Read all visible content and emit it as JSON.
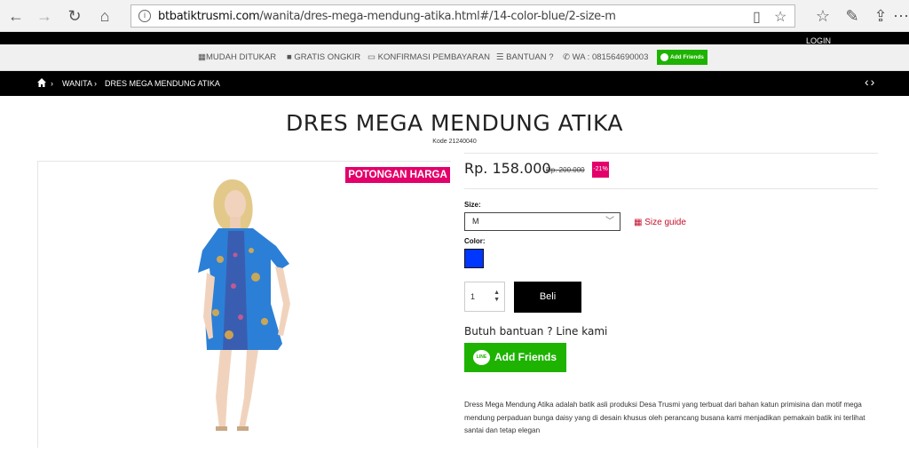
{
  "browser": {
    "url_host": "btbatiktrusmi.com",
    "url_path": "/wanita/dres-mega-mendung-atika.html#/14-color-blue/2-size-m"
  },
  "header": {
    "login": "LOGIN"
  },
  "info_bar": {
    "items": [
      "MUDAH DITUKAR",
      "GRATIS ONGKIR",
      "KONFIRMASI PEMBAYARAN",
      "BANTUAN ?",
      "WA : 081564690003"
    ],
    "add_friends": "Add Friends"
  },
  "breadcrumb": {
    "items": [
      "WANITA",
      "DRES MEGA MENDUNG ATIKA"
    ]
  },
  "product": {
    "title": "DRES MEGA MENDUNG ATIKA",
    "code": "Kode 21240040",
    "promo": "POTONGAN HARGA",
    "price": "Rp. 158.000",
    "old_price": "Rp. 200.000",
    "discount": "-21%",
    "size_label": "Size:",
    "size_value": "M",
    "size_guide": "Size guide",
    "color_label": "Color:",
    "color_hex": "#0037ff",
    "quantity": "1",
    "buy_label": "Beli",
    "help_text": "Butuh bantuan ? Line kami",
    "line_button": "Add Friends",
    "description": "Dress Mega Mendung Atika adalah batik asli produksi Desa Trusmi yang terbuat dari bahan katun primisina dan motif mega mendung perpaduan bunga daisy yang di desain khusus oleh perancang busana kami menjadikan pemakain batik ini terlihat santai dan tetap elegan"
  },
  "colors": {
    "accent_pink": "#e3006b",
    "line_green": "#1db300",
    "size_guide_red": "#c4102a"
  }
}
